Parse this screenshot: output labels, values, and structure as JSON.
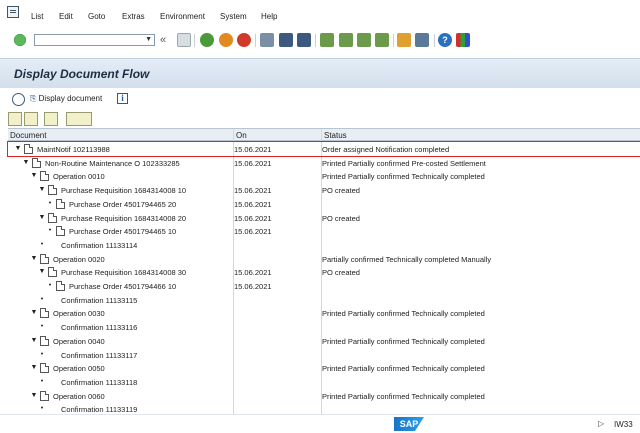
{
  "menu": [
    "List",
    "Edit",
    "Goto",
    "Extras",
    "Environment",
    "System",
    "Help"
  ],
  "menu_underline": [
    "L",
    "E",
    "G",
    "x",
    "n",
    "y",
    "H"
  ],
  "command_field": {
    "value": "",
    "placeholder": ""
  },
  "title": "Display Document Flow",
  "app_toolbar": {
    "display_document": "Display document"
  },
  "columns": {
    "document": "Document",
    "on": "On",
    "status": "Status"
  },
  "rows": [
    {
      "level": 0,
      "exp": "▼",
      "doc": true,
      "label": "MaintNotif 102113988",
      "on": "15.06.2021",
      "status": "Order assigned Notification completed",
      "selected": true
    },
    {
      "level": 1,
      "exp": "▼",
      "doc": true,
      "label": "Non-Routine Maintenance O 102333285",
      "on": "15.06.2021",
      "status": "Printed Partially confirmed Pre-costed Settlement"
    },
    {
      "level": 2,
      "exp": "▼",
      "doc": true,
      "label": "Operation 0010",
      "on": "",
      "status": "Printed Partially confirmed Technically completed"
    },
    {
      "level": 3,
      "exp": "▼",
      "doc": true,
      "label": "Purchase Requisition 1684314008 10",
      "on": "15.06.2021",
      "status": "PO created"
    },
    {
      "level": 4,
      "exp": "•",
      "doc": true,
      "label": "Purchase Order 4501794465 20",
      "on": "15.06.2021",
      "status": ""
    },
    {
      "level": 3,
      "exp": "▼",
      "doc": true,
      "label": "Purchase Requisition 1684314008 20",
      "on": "15.06.2021",
      "status": "PO created"
    },
    {
      "level": 4,
      "exp": "•",
      "doc": true,
      "label": "Purchase Order 4501794465 10",
      "on": "15.06.2021",
      "status": ""
    },
    {
      "level": 3,
      "exp": "•",
      "doc": false,
      "label": "Confirmation 11133114",
      "on": "",
      "status": ""
    },
    {
      "level": 2,
      "exp": "▼",
      "doc": true,
      "label": "Operation 0020",
      "on": "",
      "status": "Partially confirmed Technically completed Manually"
    },
    {
      "level": 3,
      "exp": "▼",
      "doc": true,
      "label": "Purchase Requisition 1684314008 30",
      "on": "15.06.2021",
      "status": "PO created"
    },
    {
      "level": 4,
      "exp": "•",
      "doc": true,
      "label": "Purchase Order 4501794466 10",
      "on": "15.06.2021",
      "status": ""
    },
    {
      "level": 3,
      "exp": "•",
      "doc": false,
      "label": "Confirmation 11133115",
      "on": "",
      "status": ""
    },
    {
      "level": 2,
      "exp": "▼",
      "doc": true,
      "label": "Operation 0030",
      "on": "",
      "status": "Printed Partially confirmed Technically completed"
    },
    {
      "level": 3,
      "exp": "•",
      "doc": false,
      "label": "Confirmation 11133116",
      "on": "",
      "status": ""
    },
    {
      "level": 2,
      "exp": "▼",
      "doc": true,
      "label": "Operation 0040",
      "on": "",
      "status": "Printed Partially confirmed Technically completed"
    },
    {
      "level": 3,
      "exp": "•",
      "doc": false,
      "label": "Confirmation 11133117",
      "on": "",
      "status": ""
    },
    {
      "level": 2,
      "exp": "▼",
      "doc": true,
      "label": "Operation 0050",
      "on": "",
      "status": "Printed Partially confirmed Technically completed"
    },
    {
      "level": 3,
      "exp": "•",
      "doc": false,
      "label": "Confirmation 11133118",
      "on": "",
      "status": ""
    },
    {
      "level": 2,
      "exp": "▼",
      "doc": true,
      "label": "Operation 0060",
      "on": "",
      "status": "Printed Partially confirmed Technically completed"
    },
    {
      "level": 3,
      "exp": "•",
      "doc": false,
      "label": "Confirmation 11133119",
      "on": "",
      "status": ""
    }
  ],
  "status_bar": {
    "logo": "SAP",
    "tcode": "IW33"
  },
  "colors": {
    "title_bg": "#d8e4f0",
    "selection_border": "#dd2222",
    "accent_blue": "#1b5ea8"
  },
  "icons": {
    "toolbar": [
      "enter-icon",
      "back-icon",
      "exit-icon",
      "cancel-icon",
      "print-icon",
      "find-icon",
      "find-next-icon",
      "first-page-icon",
      "previous-page-icon",
      "next-page-icon",
      "last-page-icon",
      "create-session-icon",
      "shortcut-icon",
      "help-icon",
      "layout-icon"
    ]
  }
}
